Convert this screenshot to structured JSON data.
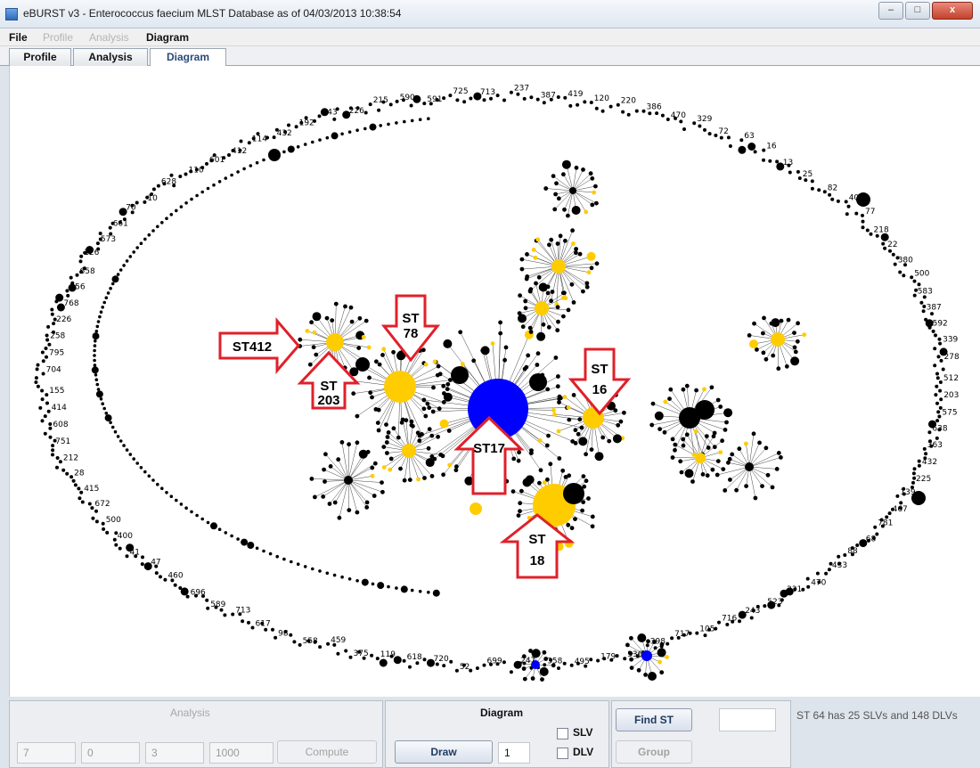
{
  "window": {
    "title": "eBURST v3 - Enterococcus faecium MLST Database as of 04/03/2013 10:38:54",
    "minimize": "–",
    "maximize": "□",
    "close": "x"
  },
  "menu": {
    "file": "File",
    "profile": "Profile",
    "analysis": "Analysis",
    "diagram": "Diagram"
  },
  "tabs": {
    "profile": "Profile",
    "analysis": "Analysis",
    "diagram": "Diagram"
  },
  "annotations": [
    {
      "id": "st412",
      "text": "ST412"
    },
    {
      "id": "st78",
      "line1": "ST",
      "line2": "78"
    },
    {
      "id": "st203",
      "line1": "ST",
      "line2": "203"
    },
    {
      "id": "st16",
      "line1": "ST",
      "line2": "16"
    },
    {
      "id": "st17",
      "text": "ST17"
    },
    {
      "id": "st18",
      "line1": "ST",
      "line2": "18"
    }
  ],
  "node_labels": [
    "512",
    "203",
    "575",
    "638",
    "363",
    "432",
    "225",
    "139",
    "467",
    "781",
    "68",
    "88",
    "433",
    "470",
    "331",
    "523",
    "243",
    "716",
    "105",
    "717",
    "398",
    "336",
    "179",
    "495",
    "358",
    "247",
    "699",
    "52",
    "720",
    "618",
    "119",
    "375",
    "459",
    "558",
    "98",
    "617",
    "713",
    "589",
    "696",
    "460",
    "47",
    "41",
    "400",
    "500",
    "672",
    "415",
    "28",
    "212",
    "751",
    "608",
    "414",
    "155",
    "704",
    "795",
    "258",
    "226",
    "768",
    "256",
    "658",
    "126",
    "573",
    "661",
    "70",
    "10",
    "628",
    "110",
    "601",
    "412",
    "114",
    "432",
    "192",
    "143",
    "226",
    "215",
    "590",
    "591",
    "725",
    "713",
    "237",
    "387",
    "419",
    "120",
    "220",
    "386",
    "470",
    "329",
    "72",
    "63",
    "16",
    "13",
    "25",
    "82",
    "40",
    "77",
    "218",
    "22",
    "380",
    "500",
    "583",
    "387",
    "592",
    "339",
    "278"
  ],
  "colors": {
    "founder": "#0000ff",
    "subgroup_founder": "#ffcc00",
    "node": "#000000",
    "arrow_border": "#e0202a"
  },
  "bottom": {
    "analysis_title": "Analysis",
    "fields": [
      "7",
      "0",
      "3",
      "1000"
    ],
    "compute": "Compute",
    "diagram_title": "Diagram",
    "draw": "Draw",
    "draw_value": "1",
    "slv": "SLV",
    "dlv": "DLV",
    "find_st": "Find ST",
    "group": "Group",
    "status": "ST 64 has 25 SLVs and 148 DLVs"
  }
}
